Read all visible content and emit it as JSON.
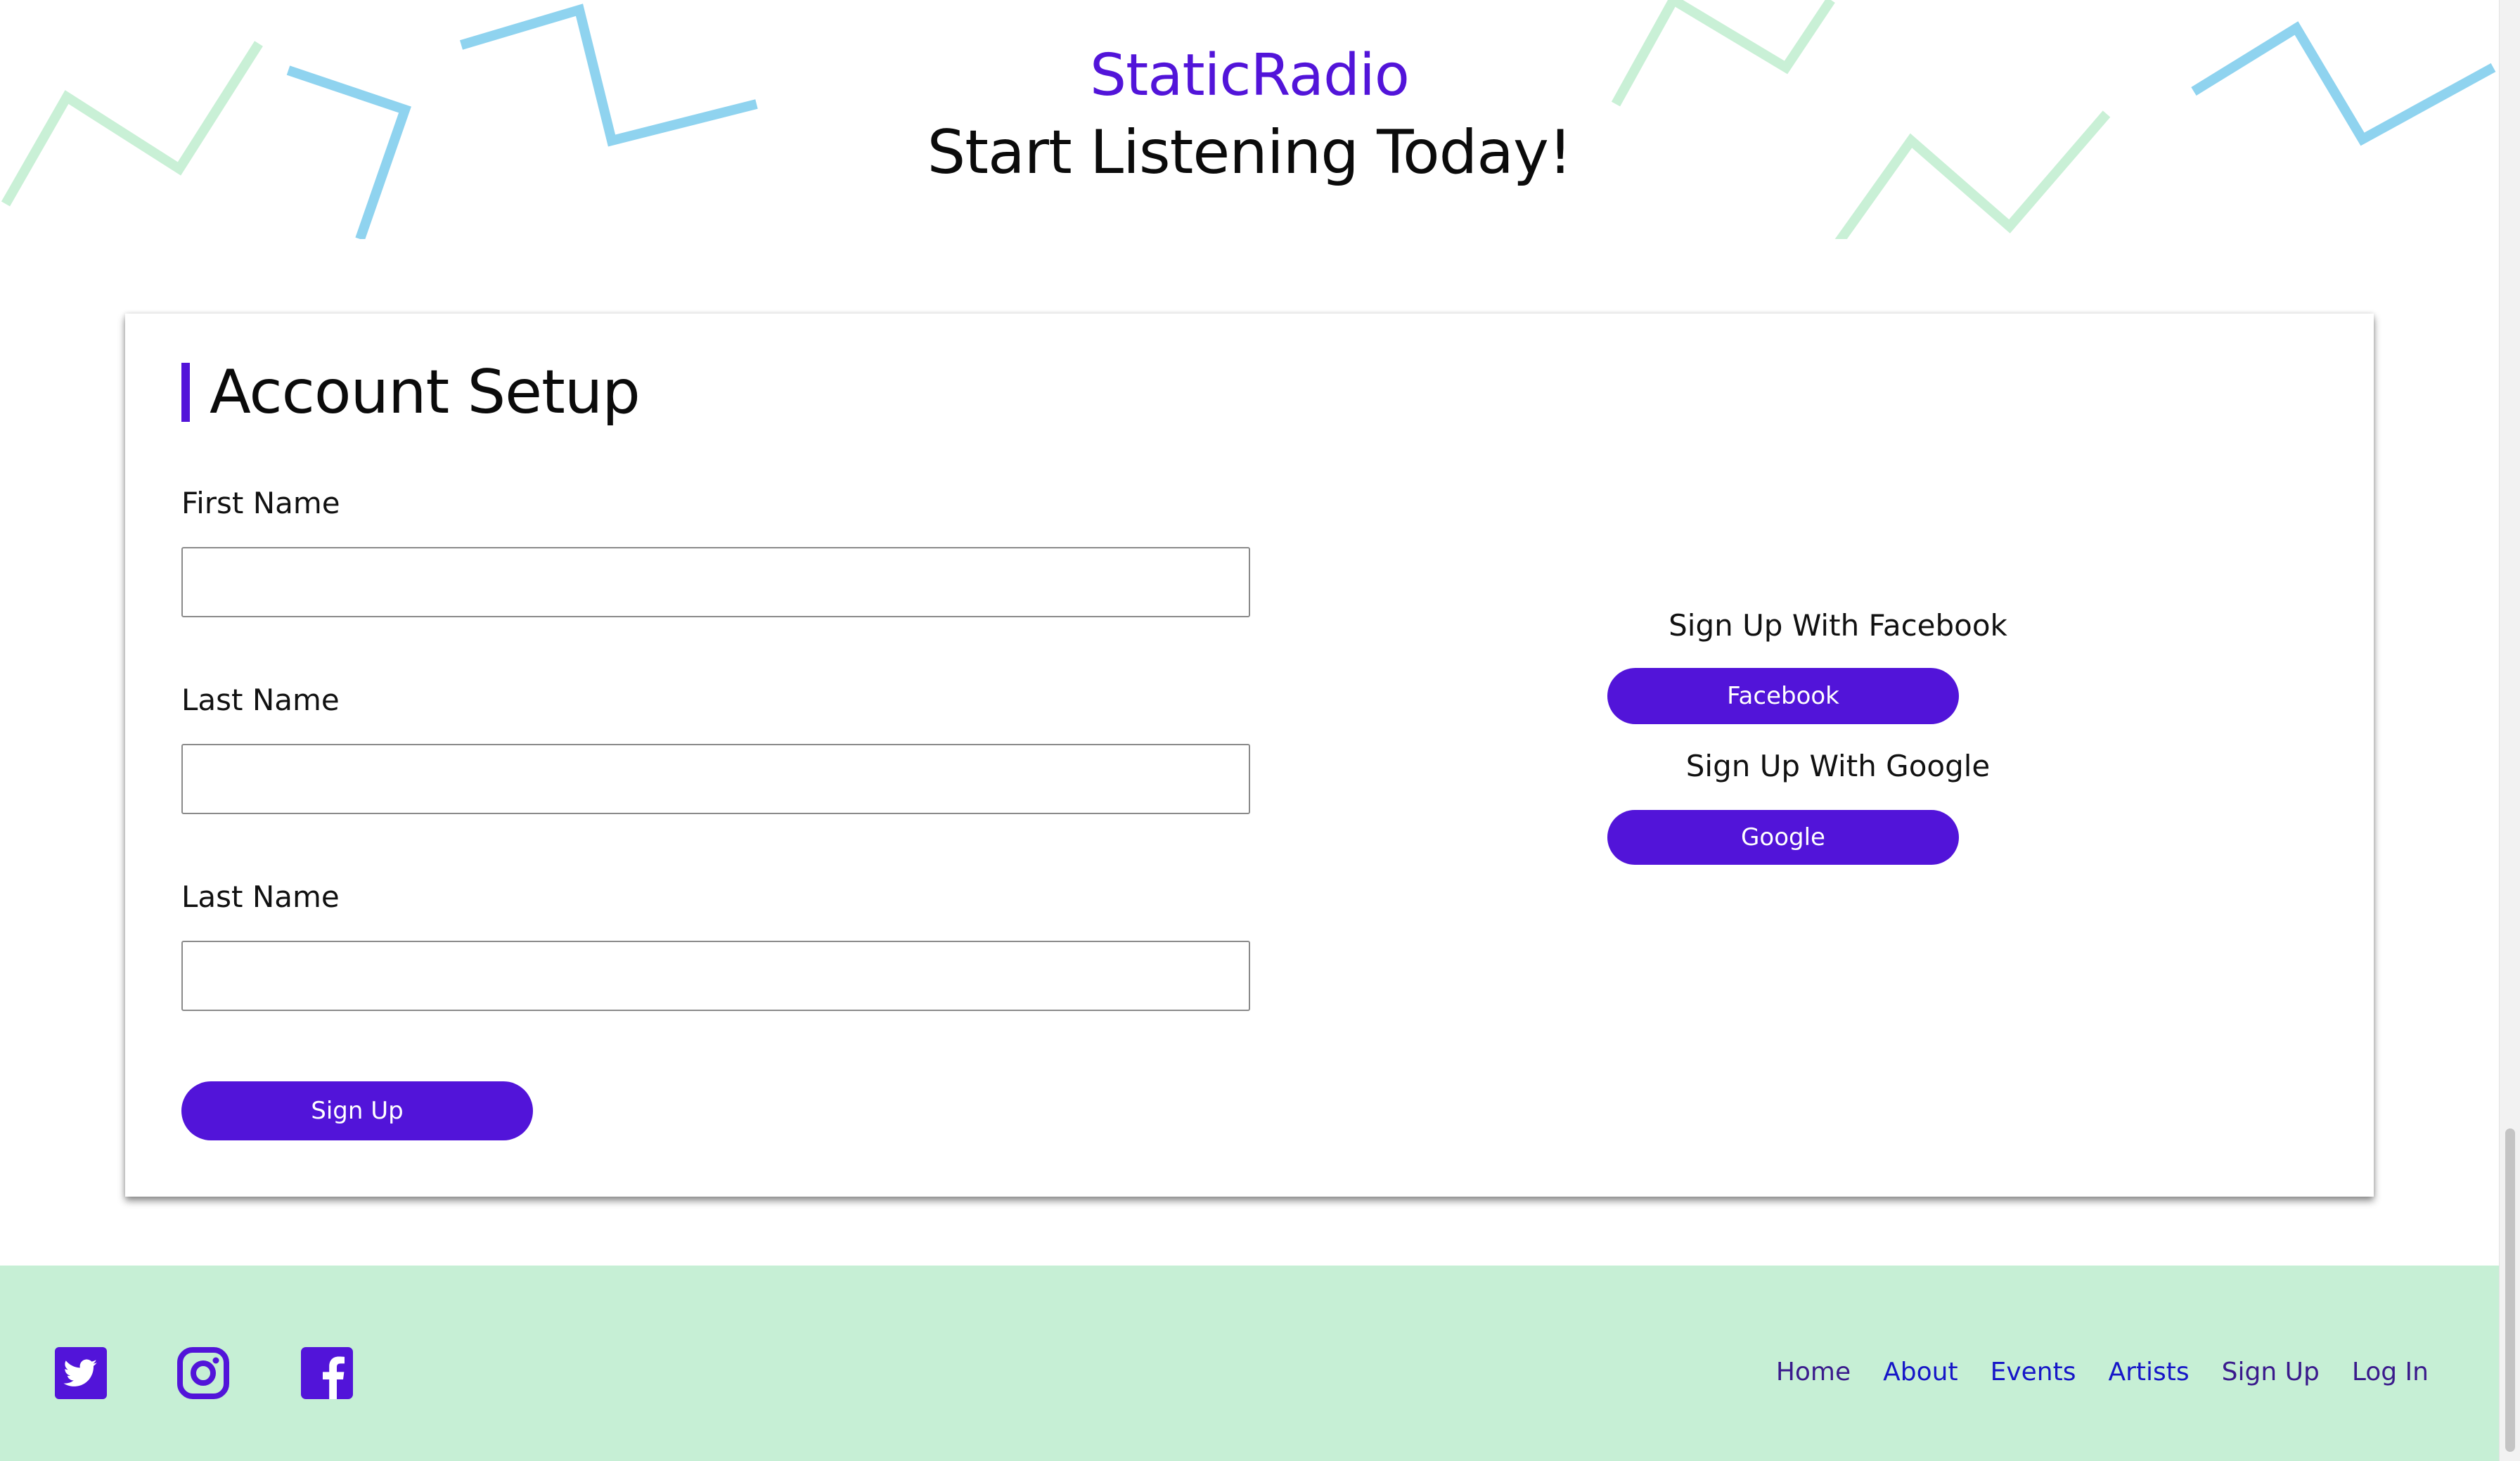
{
  "header": {
    "brand": "StaticRadio",
    "tagline": "Start Listening Today!"
  },
  "form": {
    "title": "Account Setup",
    "fields": [
      {
        "label": "First Name",
        "value": "",
        "placeholder": ""
      },
      {
        "label": "Last Name",
        "value": "",
        "placeholder": ""
      },
      {
        "label": "Last Name",
        "value": "",
        "placeholder": ""
      }
    ],
    "submit_label": "Sign Up"
  },
  "social_signup": {
    "facebook_heading": "Sign Up With Facebook",
    "facebook_button": "Facebook",
    "google_heading": "Sign Up With Google",
    "google_button": "Google"
  },
  "footer": {
    "icons": [
      "twitter-icon",
      "instagram-icon",
      "facebook-icon"
    ],
    "nav": [
      {
        "label": "Home",
        "color": "#3a1a8c"
      },
      {
        "label": "About",
        "color": "#1616c8"
      },
      {
        "label": "Events",
        "color": "#1616c8"
      },
      {
        "label": "Artists",
        "color": "#1616c8"
      },
      {
        "label": "Sign Up",
        "color": "#3a1a8c"
      },
      {
        "label": "Log In",
        "color": "#3a1a8c"
      }
    ]
  },
  "colors": {
    "accent": "#5214d9",
    "footer_bg": "#c6efd5",
    "zigzag_blue": "#8fd3ef",
    "zigzag_green": "#c9f0d6"
  }
}
